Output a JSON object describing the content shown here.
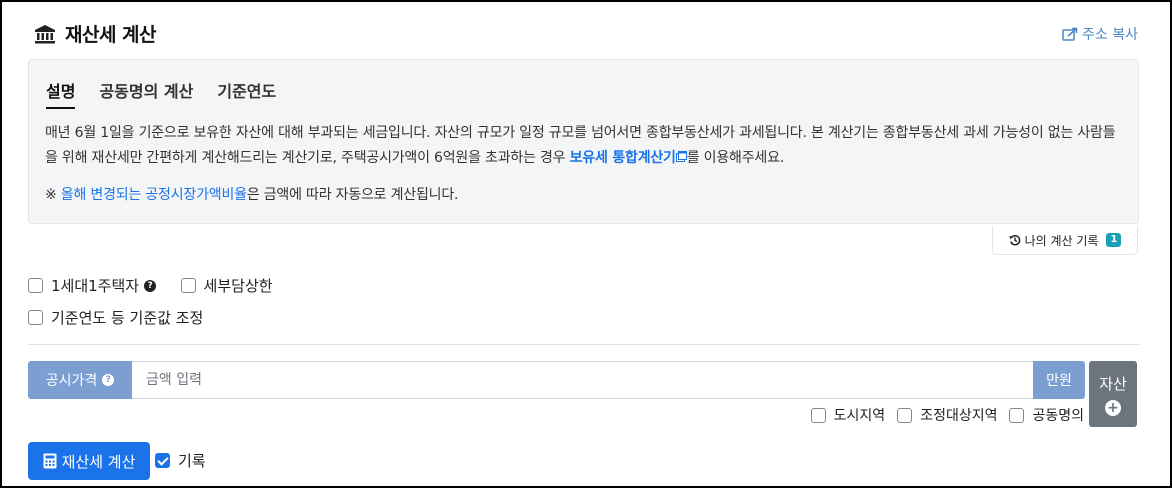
{
  "header": {
    "title": "재산세 계산",
    "copy_label": "주소 복사"
  },
  "tabs": [
    {
      "label": "설명",
      "active": true
    },
    {
      "label": "공동명의 계산",
      "active": false
    },
    {
      "label": "기준연도",
      "active": false
    }
  ],
  "description": {
    "text_part1": "매년 6월 1일을 기준으로 보유한 자산에 대해 부과되는 세금입니다. 자산의 규모가 일정 규모를 넘어서면 종합부동산세가 과세됩니다. 본 계산기는 종합부동산세 과세 가능성이 없는 사람들을 위해 재산세만 간편하게 계산해드리는 계산기로, 주택공시가액이 6억원을 초과하는 경우 ",
    "link": "보유세 통합계산기",
    "text_part2": "를 이용해주세요.",
    "note_prefix": "※ ",
    "note_link": "올해 변경되는 공정시장가액비율",
    "note_suffix": "은 금액에 따라 자동으로 계산됩니다."
  },
  "history": {
    "label": "나의 계산 기록",
    "count": "1"
  },
  "options": {
    "one_house": "1세대1주택자",
    "tax_limit": "세부담상한",
    "adjust_base": "기준연도 등 기준값 조정"
  },
  "price_input": {
    "prefix": "공시가격",
    "placeholder": "금액 입력",
    "unit": "만원",
    "asset_label": "자산"
  },
  "regions": {
    "city": "도시지역",
    "adjusted": "조정대상지역",
    "joint": "공동명의"
  },
  "actions": {
    "calculate": "재산세 계산",
    "record": "기록"
  },
  "colors": {
    "primary": "#1a73e8",
    "input_addon": "#7b9fd1",
    "asset_button": "#6c757d",
    "badge": "#17a2b8"
  }
}
